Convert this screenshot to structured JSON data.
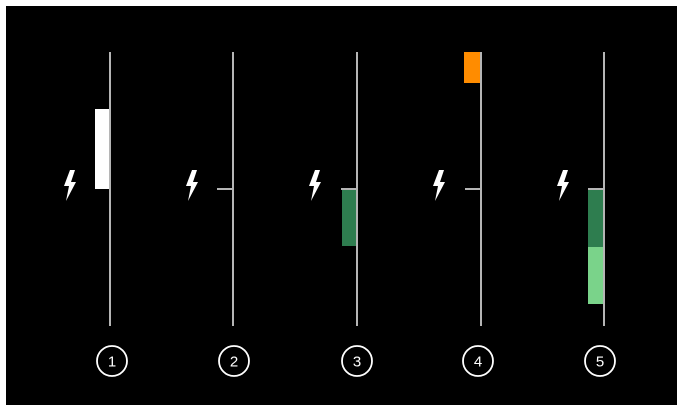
{
  "colors": {
    "background": "#000000",
    "axis": "#b5b5b5",
    "icon": "#ffffff",
    "white_block": "#ffffff",
    "dark_green": "#2e7d4f",
    "light_green": "#7ad38a",
    "orange": "#ff8c00"
  },
  "columns": [
    {
      "number": "1",
      "icon": "lightning-bolt-icon"
    },
    {
      "number": "2",
      "icon": "lightning-bolt-icon"
    },
    {
      "number": "3",
      "icon": "lightning-bolt-icon"
    },
    {
      "number": "4",
      "icon": "lightning-bolt-icon"
    },
    {
      "number": "5",
      "icon": "lightning-bolt-icon"
    }
  ]
}
